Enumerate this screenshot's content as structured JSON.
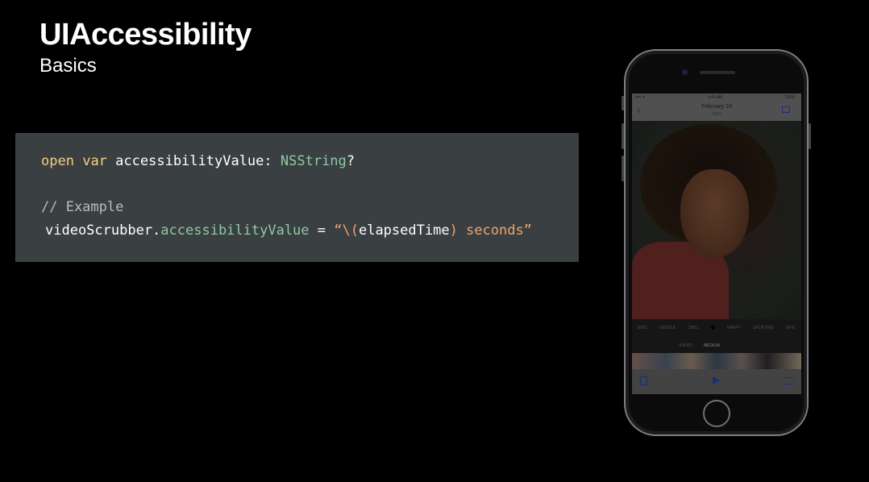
{
  "slide": {
    "title": "UIAccessibility",
    "subtitle": "Basics"
  },
  "code": {
    "line1": {
      "kw1": "open",
      "kw2": "var",
      "name": "accessibilityValue:",
      "type": "NSString",
      "suffix": "?"
    },
    "comment": "// Example",
    "line3": {
      "receiver": "videoScrubber.",
      "property": "accessibilityValue",
      "op": " = ",
      "str_open": "“\\(",
      "interp": "elapsedTime",
      "str_close": ") seconds”"
    }
  },
  "phone": {
    "status": {
      "signal": "•••• ᯤ",
      "time": "9:41 AM",
      "battery": "100%"
    },
    "nav": {
      "back": "‹",
      "title": "February 18",
      "subtitle": "2017"
    },
    "moods": [
      "EPIC",
      "GENTLE",
      "CHILL",
      "",
      "HAPPY",
      "UPLIFTING",
      "EPIC"
    ],
    "lengths": {
      "short": "SHORT",
      "medium": "MEDIUM"
    }
  },
  "colors": {
    "code_background": "#3a3f42",
    "keyword": "#f5cf7f",
    "type": "#8fc9a3",
    "string": "#f0a36b",
    "comment": "#b6bbbe"
  }
}
